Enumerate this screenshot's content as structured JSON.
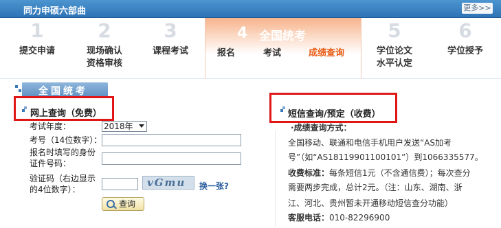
{
  "header": {
    "title": "同力申硕六部曲",
    "more_label": "更多>>"
  },
  "steps": [
    {
      "num": "1",
      "label_line1": "提交申请",
      "label_line2": ""
    },
    {
      "num": "2",
      "label_line1": "现场确认",
      "label_line2": "资格审核"
    },
    {
      "num": "3",
      "label_line1": "课程考试",
      "label_line2": ""
    },
    {
      "num": "4",
      "name": "全国统考",
      "subitems": [
        "报名",
        "考试",
        "成绩查询"
      ],
      "active_subitem": "成绩查询"
    },
    {
      "num": "5",
      "label_line1": "学位论文",
      "label_line2": "水平认定"
    },
    {
      "num": "6",
      "label_line1": "学位授予",
      "label_line2": ""
    }
  ],
  "section_title": "全国统考",
  "online": {
    "heading": "网上查询（免费）",
    "year_label": "考试年度：",
    "year_value": "2018年",
    "exam_no_label": "考号（14位数字）：",
    "id_label_line1": "报名时填写的身份",
    "id_label_line2": "证件号码：",
    "code_label_line1": "验证码（右边显示",
    "code_label_line2": "的4位数字）：",
    "captcha_text": "vGmu",
    "change_link": "换一张?",
    "query_button": "查询"
  },
  "sms": {
    "heading": "短信查询/预定（收费）",
    "method_label": "·成绩查询方式：",
    "line1": "全国移动、联通和电信手机用户发送“AS加考",
    "line2": "号”（如“AS18119901100101”）到1066335577。",
    "fee_label": "收费标准：",
    "fee_line1": "每条短信1元（不含通信费）；每次查分",
    "fee_line2": "需要两步完成，总计2元。（注：山东、湖南、浙",
    "fee_line3": "江、河北、贵州暂未开通移动短信查分功能）",
    "phone_label": "客服电话：",
    "phone_value": "010-82296900"
  },
  "colors": {
    "title_bar": "#2f74b7",
    "active_step_text": "#e85a12",
    "highlight_box": "#e01515"
  }
}
